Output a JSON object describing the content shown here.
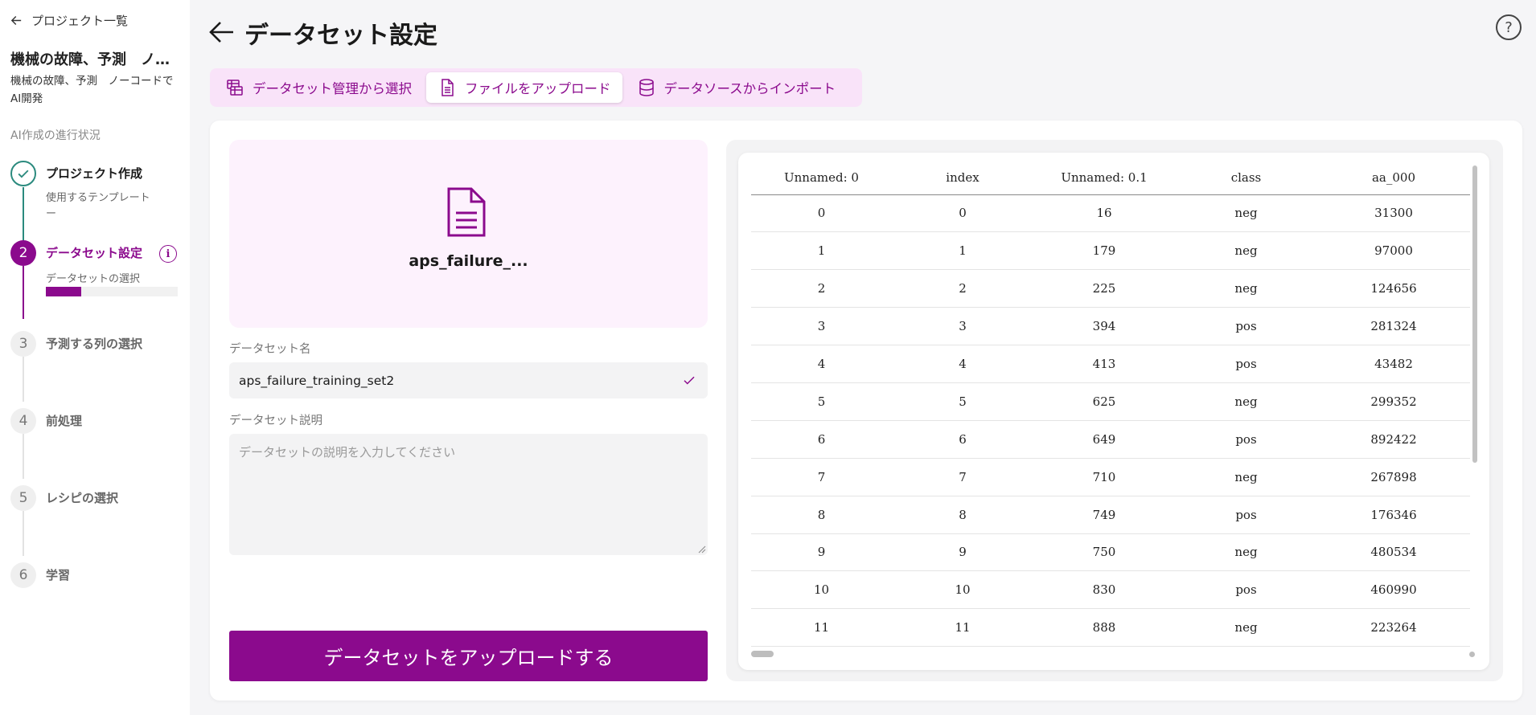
{
  "sidebar": {
    "back_label": "プロジェクト一覧",
    "project_title": "機械の故障、予測　ノーコードでAI開発",
    "project_desc": "機械の故障、予測　ノーコードでAI開発",
    "progress_heading": "AI作成の進行状況",
    "steps": [
      {
        "number": "",
        "title": "プロジェクト作成",
        "subtitle": "使用するテンプレート",
        "subtitle2": "ー",
        "state": "done"
      },
      {
        "number": "2",
        "title": "データセット設定",
        "subtitle": "データセットの選択",
        "state": "active",
        "progress": 0.27
      },
      {
        "number": "3",
        "title": "予測する列の選択",
        "state": "todo"
      },
      {
        "number": "4",
        "title": "前処理",
        "state": "todo"
      },
      {
        "number": "5",
        "title": "レシピの選択",
        "state": "todo"
      },
      {
        "number": "6",
        "title": "学習",
        "state": "todo"
      }
    ]
  },
  "header": {
    "title": "データセット設定",
    "help_symbol": "?"
  },
  "tabs": [
    {
      "label": "データセット管理から選択",
      "icon": "dataset-table-icon",
      "active": false
    },
    {
      "label": "ファイルをアップロード",
      "icon": "file-icon",
      "active": true
    },
    {
      "label": "データソースからインポート",
      "icon": "database-icon",
      "active": false
    }
  ],
  "upload": {
    "file_name": "aps_failure_...",
    "name_label": "データセット名",
    "name_value": "aps_failure_training_set2",
    "desc_label": "データセット説明",
    "desc_placeholder": "データセットの説明を入力してください",
    "button_label": "データセットをアップロードする"
  },
  "preview": {
    "columns": [
      "Unnamed: 0",
      "index",
      "Unnamed: 0.1",
      "class",
      "aa_000"
    ],
    "rows": [
      [
        "0",
        "0",
        "16",
        "neg",
        "31300"
      ],
      [
        "1",
        "1",
        "179",
        "neg",
        "97000"
      ],
      [
        "2",
        "2",
        "225",
        "neg",
        "124656"
      ],
      [
        "3",
        "3",
        "394",
        "pos",
        "281324"
      ],
      [
        "4",
        "4",
        "413",
        "pos",
        "43482"
      ],
      [
        "5",
        "5",
        "625",
        "neg",
        "299352"
      ],
      [
        "6",
        "6",
        "649",
        "pos",
        "892422"
      ],
      [
        "7",
        "7",
        "710",
        "neg",
        "267898"
      ],
      [
        "8",
        "8",
        "749",
        "pos",
        "176346"
      ],
      [
        "9",
        "9",
        "750",
        "neg",
        "480534"
      ],
      [
        "10",
        "10",
        "830",
        "pos",
        "460990"
      ],
      [
        "11",
        "11",
        "888",
        "neg",
        "223264"
      ]
    ]
  },
  "colors": {
    "accent": "#8b0a8d",
    "done": "#2b8a7e",
    "tab_bg": "#f9e3f9",
    "file_box_bg": "#fdf2fd"
  }
}
